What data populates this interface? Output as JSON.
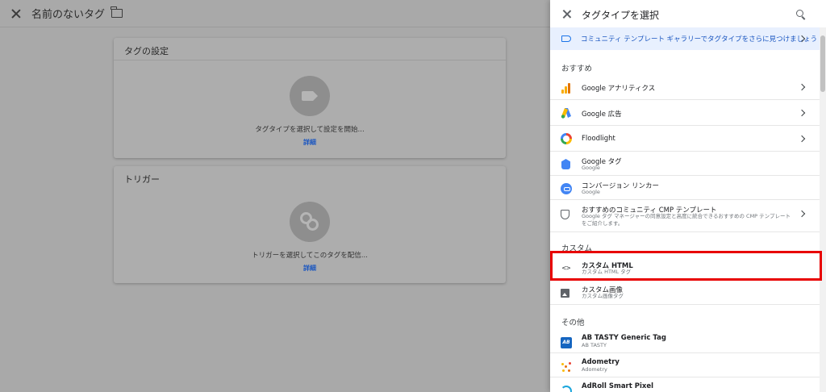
{
  "editor": {
    "title": "名前のないタグ",
    "tag_card": {
      "header": "タグの設定",
      "hint": "タグタイプを選択して設定を開始...",
      "link": "詳細"
    },
    "trigger_card": {
      "header": "トリガー",
      "hint": "トリガーを選択してこのタグを配信...",
      "link": "詳細"
    }
  },
  "panel": {
    "title": "タグタイプを選択",
    "banner": "コミュニティ テンプレート ギャラリーでタグタイプをさらに見つけましょう",
    "sections": {
      "featured": "おすすめ",
      "custom": "カスタム",
      "other": "その他"
    },
    "featured": [
      {
        "name": "Google アナリティクス",
        "sub": "",
        "icon": "google-analytics-icon"
      },
      {
        "name": "Google 広告",
        "sub": "",
        "icon": "google-ads-icon"
      },
      {
        "name": "Floodlight",
        "sub": "",
        "icon": "floodlight-icon"
      },
      {
        "name": "Google タグ",
        "sub": "Google",
        "icon": "google-tag-icon"
      },
      {
        "name": "コンバージョン リンカー",
        "sub": "Google",
        "icon": "conversion-linker-icon"
      },
      {
        "name": "おすすめのコミュニティ CMP テンプレート",
        "sub": "Google タグ マネージャーの同意設定と高度に統合できるおすすめの CMP テンプレートをご紹介します。",
        "icon": "shield-icon"
      }
    ],
    "custom": [
      {
        "name": "カスタム HTML",
        "sub": "カスタム HTML タグ",
        "icon": "code-icon"
      },
      {
        "name": "カスタム画像",
        "sub": "カスタム画像タグ",
        "icon": "image-icon"
      }
    ],
    "other": [
      {
        "name": "AB TASTY Generic Tag",
        "sub": "AB TASTY",
        "icon": "ab-tasty-icon",
        "icon_text": "AB"
      },
      {
        "name": "Adometry",
        "sub": "Adometry",
        "icon": "adometry-icon"
      },
      {
        "name": "AdRoll Smart Pixel",
        "sub": "",
        "icon": "adroll-icon"
      }
    ]
  },
  "colors": {
    "accent": "#1a73e8",
    "banner_bg": "#e8f0fe",
    "highlight": "#e80000",
    "overlay": "#a9a9a9"
  }
}
